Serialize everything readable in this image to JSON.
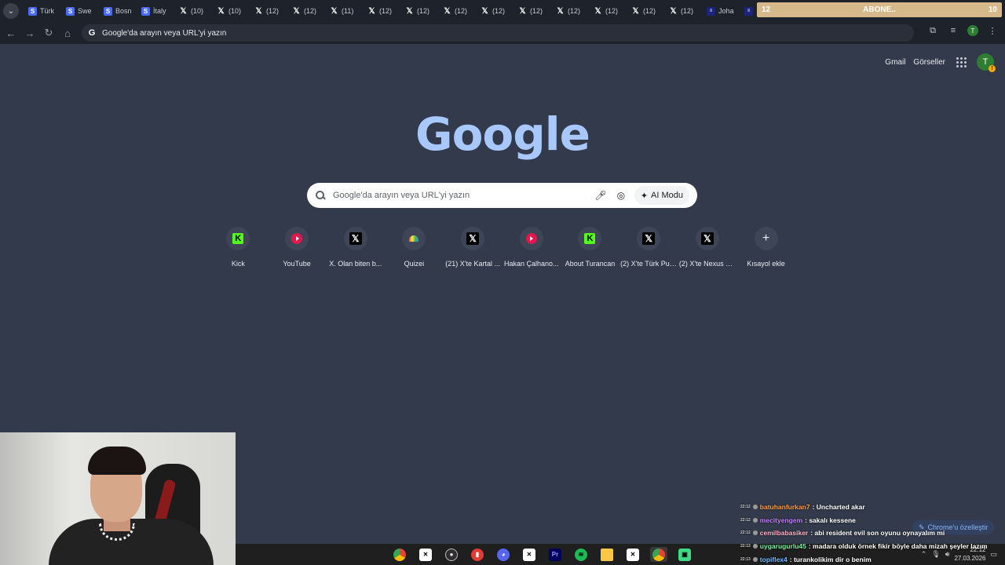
{
  "tabstrip": {
    "tabs": [
      {
        "title": "Türk",
        "icon": "blue-doc-icon"
      },
      {
        "title": "Swe",
        "icon": "blue-doc-icon"
      },
      {
        "title": "Bosn",
        "icon": "blue-doc-icon"
      },
      {
        "title": "İtaly",
        "icon": "blue-doc-icon"
      },
      {
        "title": "(10)",
        "icon": "x-icon"
      },
      {
        "title": "(10)",
        "icon": "x-icon"
      },
      {
        "title": "(12)",
        "icon": "x-icon"
      },
      {
        "title": "(12)",
        "icon": "x-icon"
      },
      {
        "title": "(11)",
        "icon": "x-icon"
      },
      {
        "title": "(12)",
        "icon": "x-icon"
      },
      {
        "title": "(12)",
        "icon": "x-icon"
      },
      {
        "title": "(12)",
        "icon": "x-icon"
      },
      {
        "title": "(12)",
        "icon": "x-icon"
      },
      {
        "title": "(12)",
        "icon": "x-icon"
      },
      {
        "title": "(12)",
        "icon": "x-icon"
      },
      {
        "title": "(12)",
        "icon": "x-icon"
      },
      {
        "title": "(12)",
        "icon": "x-icon"
      },
      {
        "title": "(12)",
        "icon": "x-icon"
      },
      {
        "title": "Joha",
        "icon": "site-icon"
      },
      {
        "title": "",
        "icon": "site-icon"
      }
    ],
    "abone": {
      "left": "12",
      "center": "ABONE..",
      "right": "10"
    }
  },
  "toolbar": {
    "address_placeholder": "Google'da arayın veya URL'yi yazın",
    "avatar_letter": "T"
  },
  "header": {
    "gmail": "Gmail",
    "images": "Görseller",
    "avatar_letter": "T"
  },
  "logo": "Google",
  "search": {
    "placeholder": "Google'da arayın veya URL'yi yazın",
    "ai_mode": "AI Modu"
  },
  "shortcuts": [
    {
      "label": "Kick",
      "icon": "kick"
    },
    {
      "label": "YouTube",
      "icon": "youtube"
    },
    {
      "label": "X. Olan biten b...",
      "icon": "x"
    },
    {
      "label": "Quizei",
      "icon": "quiz"
    },
    {
      "label": "(21) X'te Kartal ...",
      "icon": "x"
    },
    {
      "label": "Hakan Çalhano...",
      "icon": "youtube"
    },
    {
      "label": "About Turancan",
      "icon": "kick"
    },
    {
      "label": "(2) X'te Türk Pulse",
      "icon": "x"
    },
    {
      "label": "(2) X'te Nexus S...",
      "icon": "x"
    },
    {
      "label": "Kısayol ekle",
      "icon": "plus"
    }
  ],
  "customize": "Chrome'u özelleştir",
  "chat": [
    {
      "time": "22:12",
      "user": "batuhanfurkan7",
      "color": "#ff9f43",
      "msg": ": Uncharted akar"
    },
    {
      "time": "22:12",
      "user": "mecityengem",
      "color": "#c77dff",
      "msg": ": sakalı kessene"
    },
    {
      "time": "22:12",
      "user": "cemilbabasiker",
      "color": "#ffb3c6",
      "msg": ": abi resident evil son oyunu oynayalım mi"
    },
    {
      "time": "22:13",
      "user": "uygarugurlu45",
      "color": "#7bed9f",
      "msg": ": madara olduk örnek fikir böyle daha mizah şeyler lazım"
    },
    {
      "time": "22:13",
      "user": "topiflex4",
      "color": "#74b9ff",
      "msg": ": turankolikim dir o benim"
    }
  ],
  "taskbar": {
    "time": "22:12",
    "date": "27.03.2026"
  }
}
